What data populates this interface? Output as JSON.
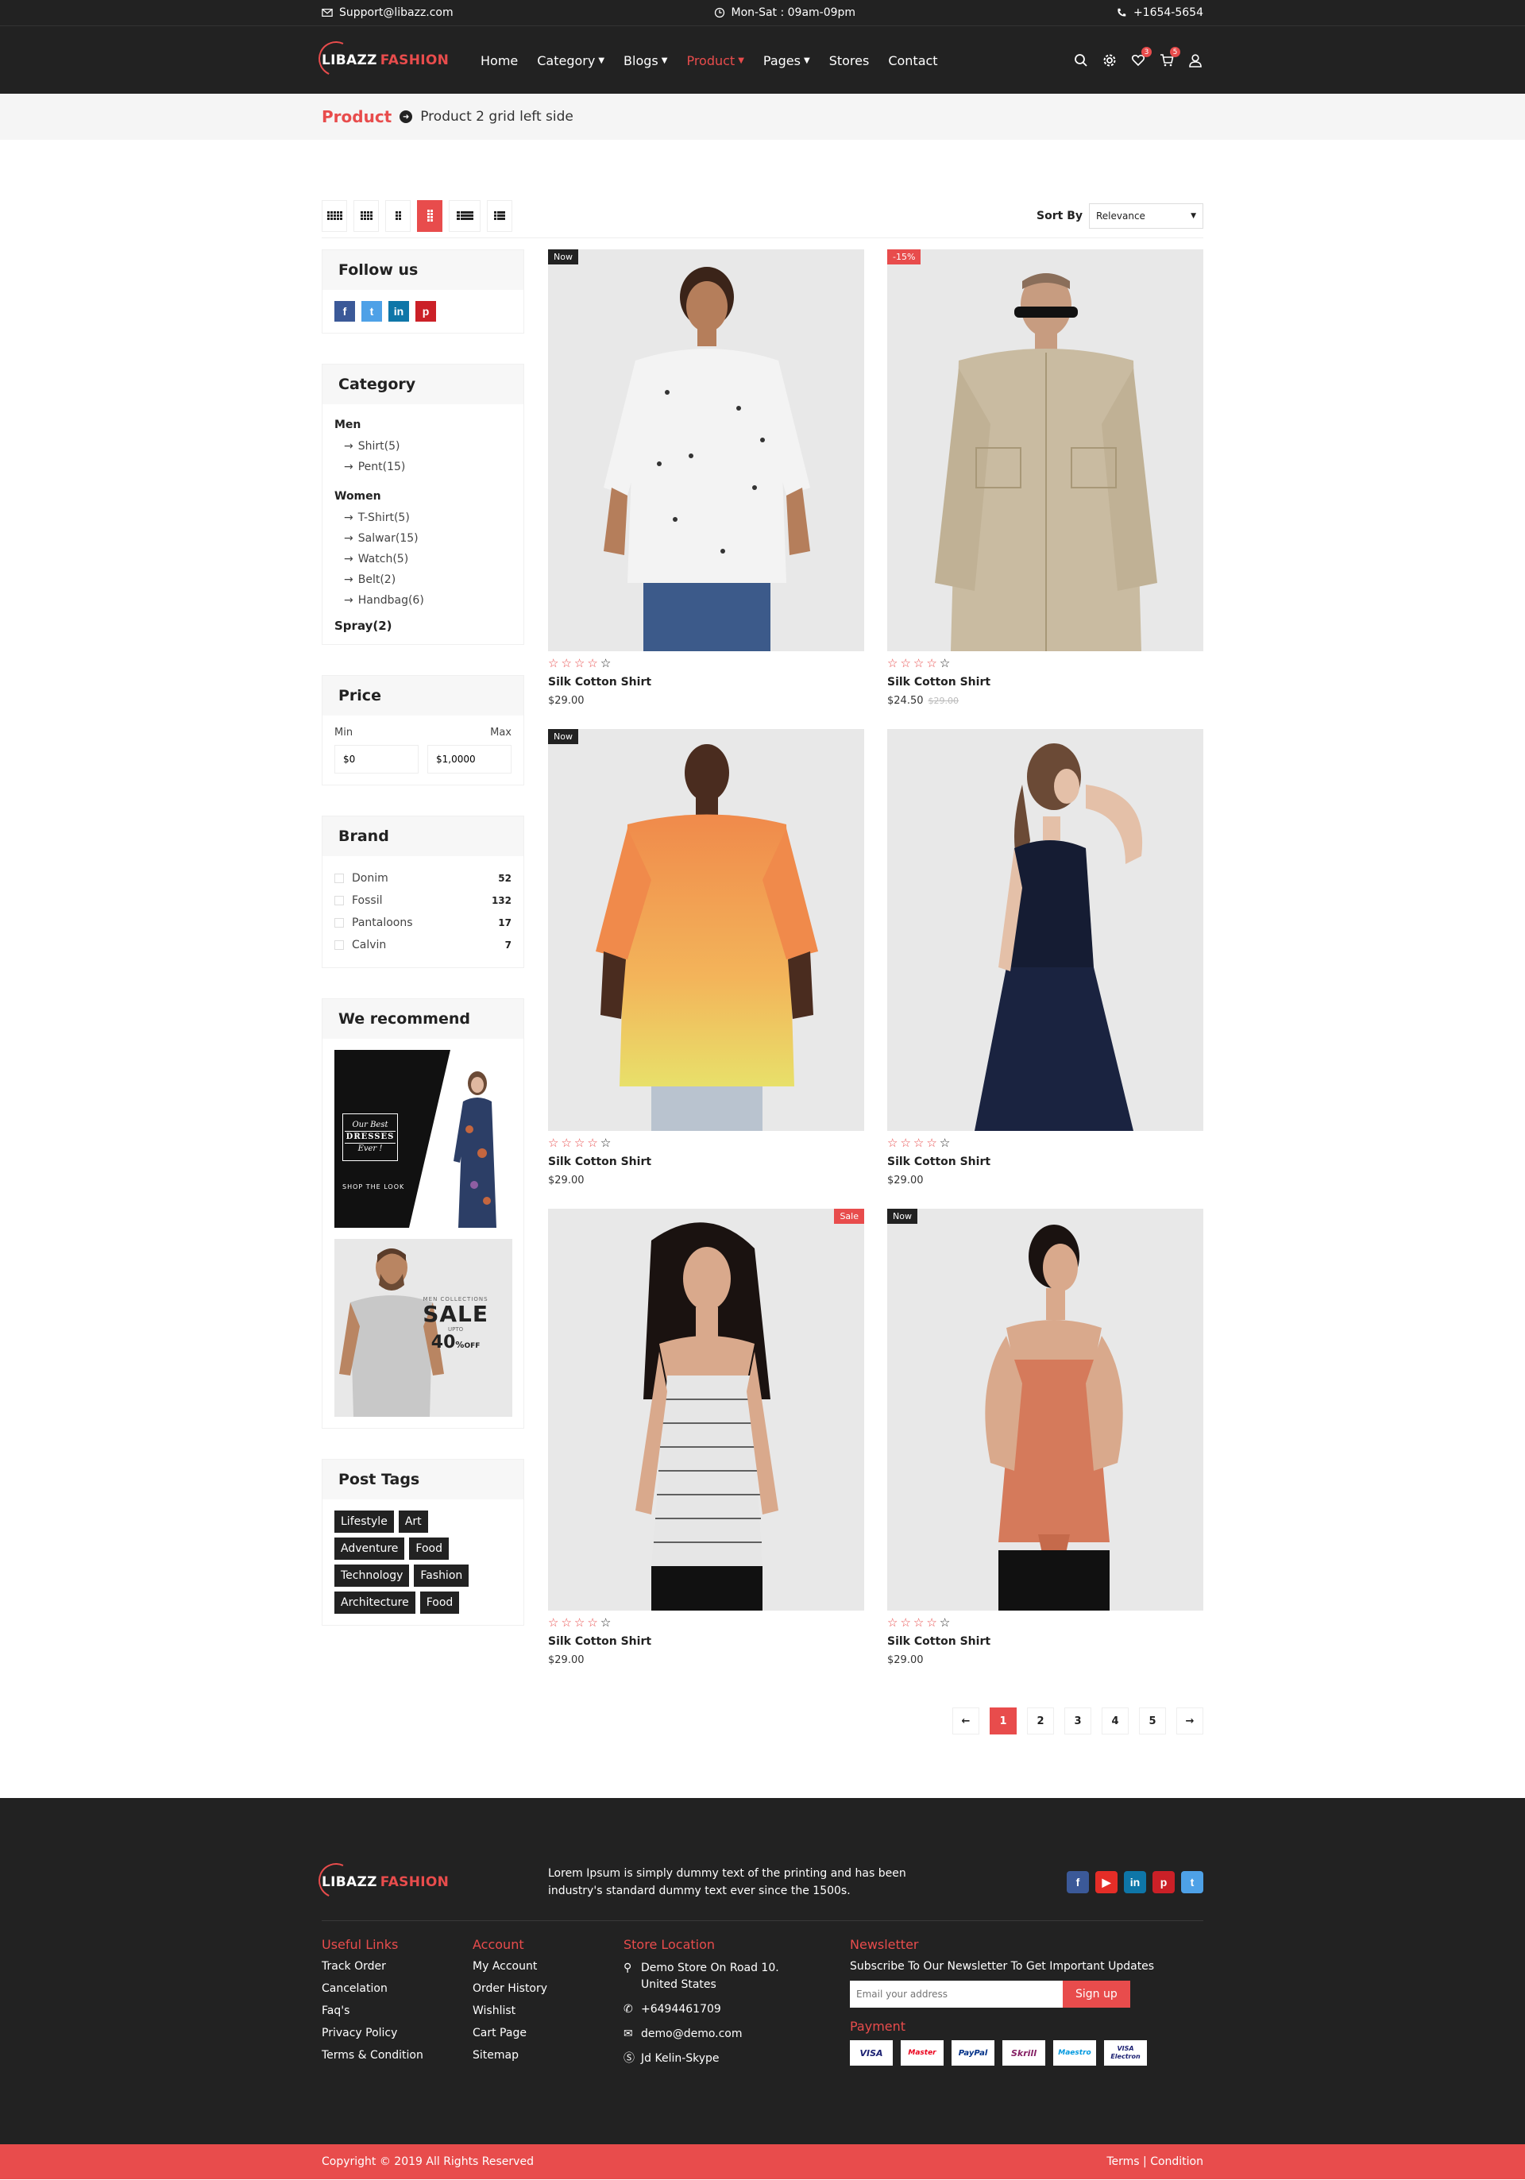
{
  "topbar": {
    "email": "Support@libazz.com",
    "hours": "Mon-Sat : 09am-09pm",
    "phone": "+1654-5654"
  },
  "header": {
    "logo_part1": "LIBAZZ",
    "logo_part2": "FASHION",
    "nav": [
      "Home",
      "Category",
      "Blogs",
      "Product",
      "Pages",
      "Stores",
      "Contact"
    ],
    "wishlist_count": "3",
    "cart_count": "5"
  },
  "breadcrumb": {
    "root": "Product",
    "current": "Product 2 grid left side"
  },
  "toolbar": {
    "sort_label": "Sort By",
    "sort_value": "Relevance"
  },
  "sidebar": {
    "follow_title": "Follow us",
    "category_title": "Category",
    "men_label": "Men",
    "men_items": [
      "Shirt(5)",
      "Pent(15)"
    ],
    "women_label": "Women",
    "women_items": [
      "T-Shirt(5)",
      "Salwar(15)",
      "Watch(5)",
      "Belt(2)",
      "Handbag(6)"
    ],
    "spray_label": "Spray(2)",
    "price_title": "Price",
    "price_min_label": "Min",
    "price_max_label": "Max",
    "price_min_value": "$0",
    "price_max_value": "$1,0000",
    "brand_title": "Brand",
    "brands": [
      {
        "name": "Donim",
        "count": "52"
      },
      {
        "name": "Fossil",
        "count": "132"
      },
      {
        "name": "Pantaloons",
        "count": "17"
      },
      {
        "name": "Calvin",
        "count": "7"
      }
    ],
    "recommend_title": "We recommend",
    "promo1_line1": "Our Best",
    "promo1_line2": "DRESSES",
    "promo1_line3": "Ever !",
    "promo1_shop": "SHOP THE LOOK",
    "promo2_top": "MEN COLLECTIONS",
    "promo2_sale": "SALE",
    "promo2_upto": "UPTO",
    "promo2_off": "40",
    "promo2_percent": "%",
    "promo2_off_word": "OFF",
    "tags_title": "Post Tags",
    "tags": [
      "Lifestyle",
      "Art",
      "Adventure",
      "Food",
      "Technology",
      "Fashion",
      "Architecture",
      "Food"
    ]
  },
  "products": [
    {
      "label": "Now",
      "label_side": "left",
      "title": "Silk Cotton Shirt",
      "price": "$29.00",
      "old_price": "",
      "rating": 0
    },
    {
      "label": "-15%",
      "label_side": "left",
      "title": "Silk Cotton Shirt",
      "price": "$24.50",
      "old_price": "$29.00",
      "rating": 0
    },
    {
      "label": "Now",
      "label_side": "left",
      "title": "Silk Cotton Shirt",
      "price": "$29.00",
      "old_price": "",
      "rating": 0
    },
    {
      "label": "",
      "label_side": "",
      "title": "Silk Cotton Shirt",
      "price": "$29.00",
      "old_price": "",
      "rating": 0
    },
    {
      "label": "Sale",
      "label_side": "right",
      "title": "Silk Cotton Shirt",
      "price": "$29.00",
      "old_price": "",
      "rating": 0
    },
    {
      "label": "Now",
      "label_side": "left",
      "title": "Silk Cotton Shirt",
      "price": "$29.00",
      "old_price": "",
      "rating": 0
    }
  ],
  "pagination": {
    "prev": "←",
    "pages": [
      "1",
      "2",
      "3",
      "4",
      "5"
    ],
    "next": "→",
    "current": "1"
  },
  "footer": {
    "logo_part1": "LIBAZZ",
    "logo_part2": "FASHION",
    "description": "Lorem Ipsum is simply dummy text of the printing and has been industry's standard dummy text ever since the 1500s.",
    "useful_title": "Useful Links",
    "useful_links": [
      "Track Order",
      "Cancelation",
      "Faq's",
      "Privacy Policy",
      "Terms & Condition"
    ],
    "account_title": "Account",
    "account_links": [
      "My Account",
      "Order History",
      "Wishlist",
      "Cart Page",
      "Sitemap"
    ],
    "store_title": "Store Location",
    "store_address": "Demo Store On Road 10. United States",
    "store_phone": "+6494461709",
    "store_email": "demo@demo.com",
    "store_skype": "Jd Kelin-Skype",
    "newsletter_title": "Newsletter",
    "newsletter_text": "Subscribe To Our Newsletter To Get Important Updates",
    "newsletter_placeholder": "Email your address",
    "newsletter_button": "Sign up",
    "payment_title": "Payment",
    "payments": [
      "VISA",
      "Master",
      "PayPal",
      "Skrill",
      "Maestro",
      "VISA Electron"
    ],
    "copyright": "Copyright © 2019 All Rights Reserved",
    "terms": "Terms | Condition"
  },
  "colors": {
    "accent": "#e84c4c",
    "dark": "#222222"
  }
}
